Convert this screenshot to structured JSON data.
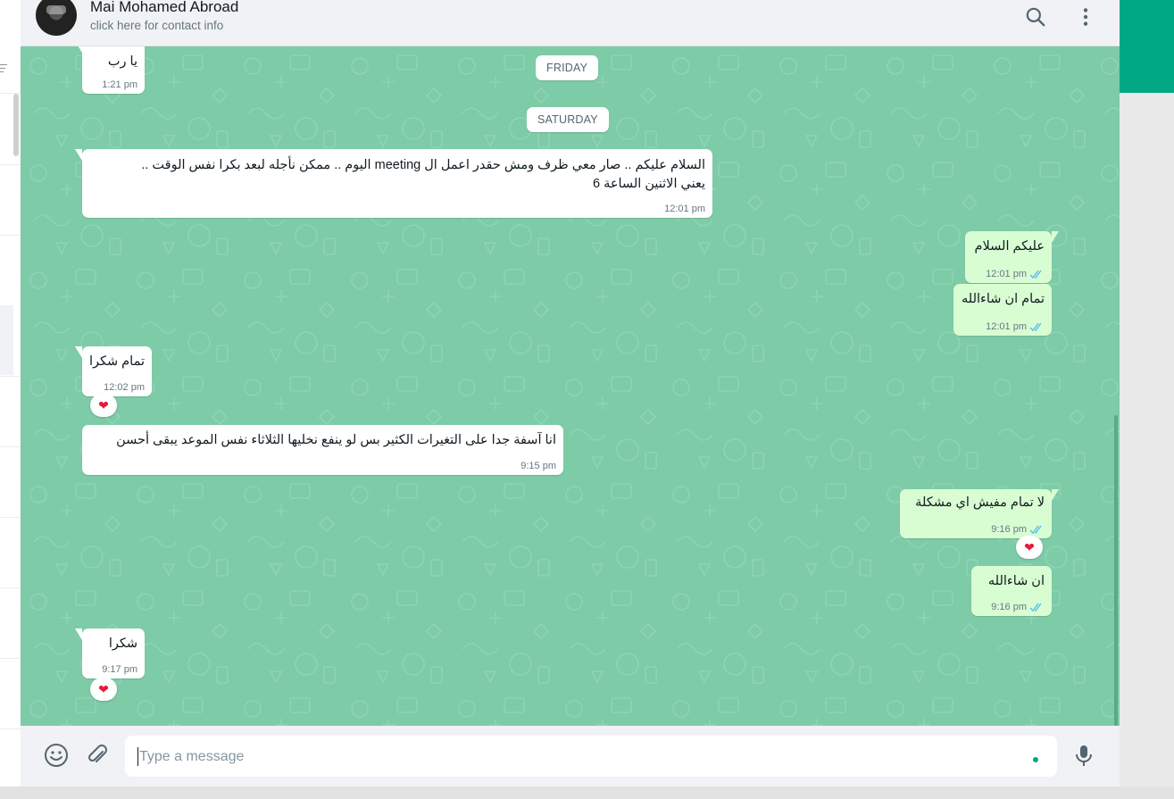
{
  "header": {
    "contact_name": "Mai Mohamed Abroad",
    "contact_subtitle": "click here for contact info",
    "search_icon": "search-icon",
    "menu_icon": "kebab-menu-icon"
  },
  "colors": {
    "accent": "#00a884",
    "chat_bg": "#7ecba7",
    "outgoing_bubble": "#d9fdd3",
    "incoming_bubble": "#ffffff",
    "read_ticks": "#53bdeb"
  },
  "days": {
    "friday": "FRIDAY",
    "saturday": "SATURDAY"
  },
  "messages": [
    {
      "dir": "in",
      "text": "يا رب",
      "time": "1:21 pm"
    },
    {
      "dir": "in",
      "text_line1": "السلام عليكم .. صار معي ظرف ومش حقدر اعمل ال meeting اليوم .. ممكن نأجله لبعد بكرا نفس الوقت ..",
      "text_line2": "يعني الاثنين الساعة 6",
      "time": "12:01 pm"
    },
    {
      "dir": "out",
      "text": "عليكم السلام",
      "time": "12:01 pm"
    },
    {
      "dir": "out",
      "text": "تمام ان شاءالله",
      "time": "12:01 pm"
    },
    {
      "dir": "in",
      "text": "تمام شكرا",
      "time": "12:02 pm",
      "reaction": "❤"
    },
    {
      "dir": "in",
      "text": "انا آسفة جدا على التغيرات الكثير بس لو ينفع نخليها الثلاثاء نفس الموعد يبقى أحسن",
      "time": "9:15 pm"
    },
    {
      "dir": "out",
      "text": "لا تمام مفيش اي مشكلة",
      "time": "9:16 pm",
      "reaction": "❤"
    },
    {
      "dir": "out",
      "text": "ان شاءالله",
      "time": "9:16 pm"
    },
    {
      "dir": "in",
      "text": "شكرا",
      "time": "9:17 pm",
      "reaction": "❤"
    }
  ],
  "composer": {
    "placeholder": "Type a message",
    "emoji_icon": "emoji-icon",
    "attach_icon": "paperclip-icon",
    "mic_icon": "microphone-icon"
  }
}
